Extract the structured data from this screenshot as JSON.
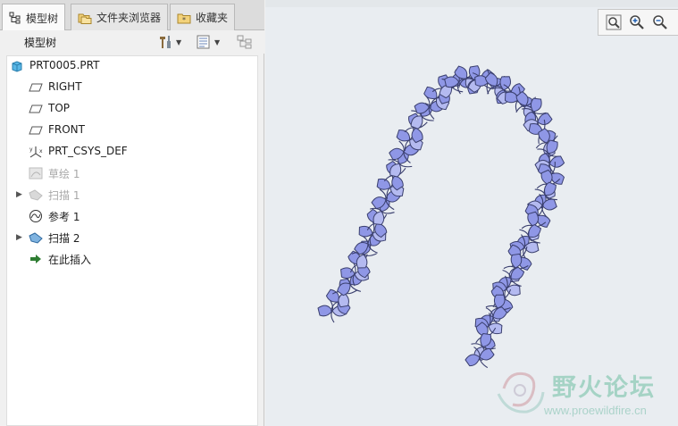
{
  "navigator": {
    "tabs": [
      {
        "label": "模型树",
        "icon": "model-tree-icon"
      },
      {
        "label": "文件夹浏览器",
        "icon": "folder-browser-icon"
      },
      {
        "label": "收藏夹",
        "icon": "favorites-icon"
      }
    ],
    "tree_title": "模型树",
    "toolbar": {
      "settings_icon": "settings-tools-icon",
      "show_icon": "show-columns-icon",
      "filter_icon": "filter-icon"
    }
  },
  "tree": {
    "items": [
      {
        "label": "PRT0005.PRT",
        "icon": "part-icon",
        "expander": "",
        "dim": false
      },
      {
        "label": "RIGHT",
        "icon": "datum-plane-icon",
        "expander": "",
        "dim": false
      },
      {
        "label": "TOP",
        "icon": "datum-plane-icon",
        "expander": "",
        "dim": false
      },
      {
        "label": "FRONT",
        "icon": "datum-plane-icon",
        "expander": "",
        "dim": false
      },
      {
        "label": "PRT_CSYS_DEF",
        "icon": "coordinate-system-icon",
        "expander": "",
        "dim": false
      },
      {
        "label": "草绘 1",
        "icon": "sketch-icon",
        "expander": "",
        "dim": true
      },
      {
        "label": "扫描 1",
        "icon": "sweep-icon",
        "expander": "▶",
        "dim": true
      },
      {
        "label": "参考 1",
        "icon": "reference-icon",
        "expander": "",
        "dim": false
      },
      {
        "label": "扫描 2",
        "icon": "sweep-icon",
        "expander": "▶",
        "dim": false
      },
      {
        "label": "在此插入",
        "icon": "insert-here-arrow-icon",
        "expander": "",
        "dim": false
      }
    ]
  },
  "view_toolbar": {
    "buttons": [
      "refit-icon",
      "zoom-in-icon",
      "zoom-out-icon"
    ]
  },
  "watermark": {
    "title": "野火论坛",
    "url": "www.proewildfire.cn"
  },
  "colors": {
    "model_fill": "#8f97e6",
    "model_dark": "#3a3f6e",
    "background": "#e9edf1",
    "accent_insert": "#2e7d32"
  }
}
